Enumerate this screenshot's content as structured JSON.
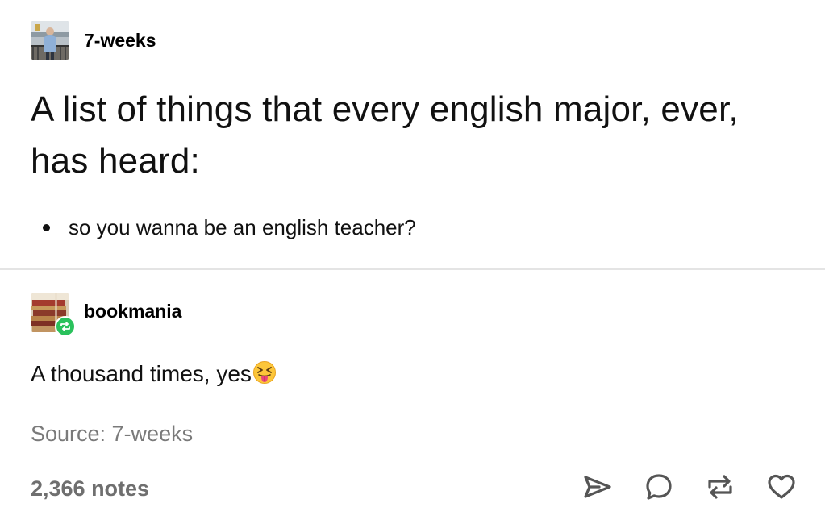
{
  "original_post": {
    "username": "7-weeks",
    "title": "A list of things that every english major, ever, has heard:",
    "bullets": [
      "so you wanna be an english teacher?"
    ]
  },
  "reblog": {
    "username": "bookmania",
    "text": "A thousand times, yes",
    "emoji_icon": "squinting-face-with-tongue-icon"
  },
  "footer": {
    "source": "Source: 7-weeks",
    "notes": "2,366 notes",
    "actions": [
      {
        "name": "share",
        "icon": "paper-plane-icon"
      },
      {
        "name": "reply",
        "icon": "speech-bubble-icon"
      },
      {
        "name": "reblog",
        "icon": "reblog-icon"
      },
      {
        "name": "like",
        "icon": "heart-icon"
      }
    ]
  },
  "colors": {
    "reblog_badge": "#2ac15c",
    "divider": "#e4e4e4",
    "muted_text": "#7a7a7a",
    "icon": "#555555"
  }
}
